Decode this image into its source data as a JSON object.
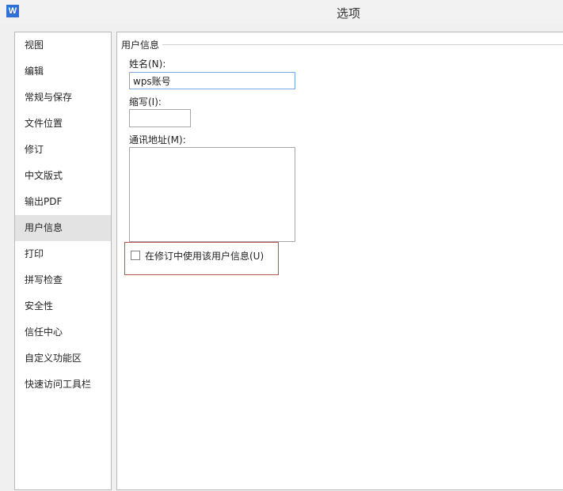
{
  "window": {
    "title": "选项",
    "app_icon_glyph": "W"
  },
  "sidebar": {
    "items": [
      {
        "label": "视图"
      },
      {
        "label": "编辑"
      },
      {
        "label": "常规与保存"
      },
      {
        "label": "文件位置"
      },
      {
        "label": "修订"
      },
      {
        "label": "中文版式"
      },
      {
        "label": "输出PDF"
      },
      {
        "label": "用户信息",
        "selected": true
      },
      {
        "label": "打印"
      },
      {
        "label": "拼写检查"
      },
      {
        "label": "安全性"
      },
      {
        "label": "信任中心"
      },
      {
        "label": "自定义功能区"
      },
      {
        "label": "快速访问工具栏"
      }
    ]
  },
  "user_info": {
    "group_title": "用户信息",
    "name_label": "姓名(N):",
    "name_value": "wps账号",
    "initials_label": "缩写(I):",
    "initials_value": "",
    "address_label": "通讯地址(M):",
    "address_value": "",
    "use_in_revisions_label": "在修订中使用该用户信息(U)",
    "use_in_revisions_checked": false
  },
  "colors": {
    "highlight_border": "#b55252",
    "selected_item_bg": "#e3e3e3",
    "app_icon": "#2f6fd6"
  }
}
